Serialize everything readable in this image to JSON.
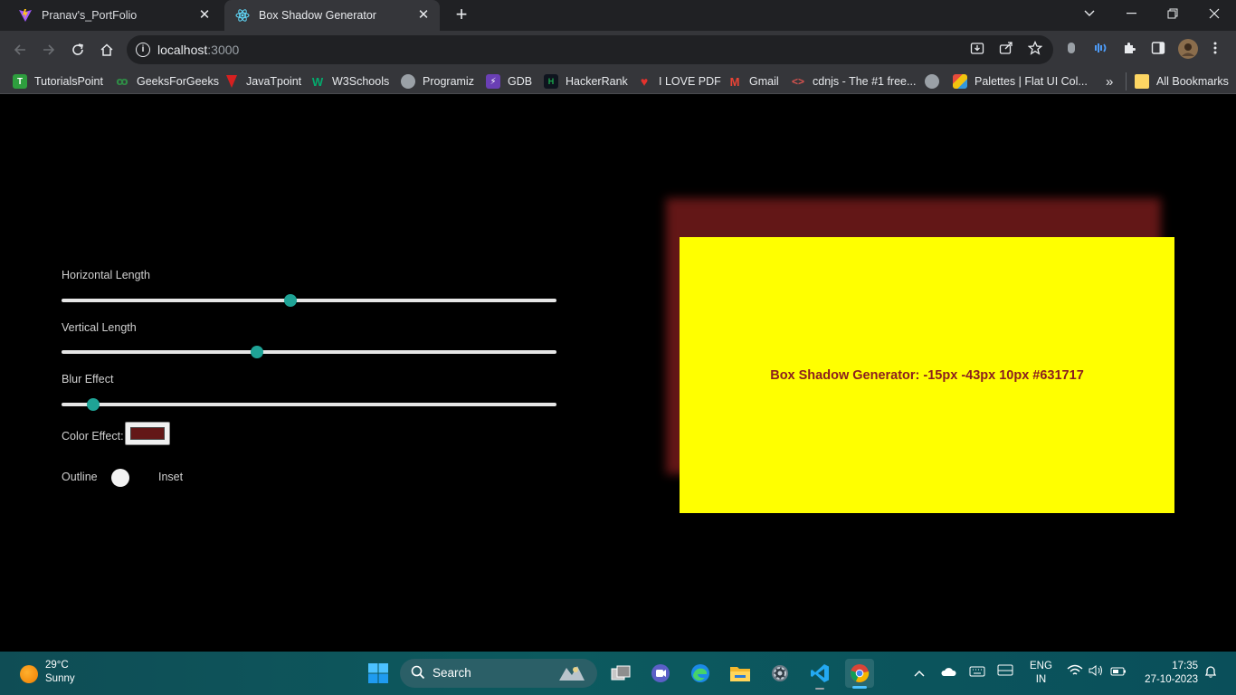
{
  "browser": {
    "tabs": [
      {
        "title": "Pranav's_PortFolio",
        "active": false,
        "icon": "vite-icon"
      },
      {
        "title": "Box Shadow Generator",
        "active": true,
        "icon": "react-icon"
      }
    ],
    "url_host": "localhost",
    "url_port": ":3000",
    "bookmarks": [
      {
        "label": "TutorialsPoint",
        "color": "#2e9e3e",
        "glyph": "T"
      },
      {
        "label": "GeeksForGeeks",
        "color": "#2f8d46",
        "glyph": "G"
      },
      {
        "label": "JavaTpoint",
        "color": "#d62020",
        "glyph": "J"
      },
      {
        "label": "W3Schools",
        "color": "#04aa6d",
        "glyph": "W"
      },
      {
        "label": "Programiz",
        "color": "#5f6368",
        "glyph": "P"
      },
      {
        "label": "GDB",
        "color": "#6a3fb5",
        "glyph": "G"
      },
      {
        "label": "HackerRank",
        "color": "#1ba94c",
        "glyph": "H"
      },
      {
        "label": "I LOVE PDF",
        "color": "#e5322d",
        "glyph": "I"
      },
      {
        "label": "Gmail",
        "color": "#ea4335",
        "glyph": "M"
      },
      {
        "label": "cdnjs - The #1 free...",
        "color": "#d9534f",
        "glyph": "<>"
      },
      {
        "label": "",
        "color": "#5f6368",
        "glyph": ""
      },
      {
        "label": "Palettes | Flat UI Col...",
        "color": "#e67e22",
        "glyph": "P"
      }
    ],
    "bookmarks_overflow": "»",
    "all_bookmarks": "All Bookmarks"
  },
  "controls": {
    "horizontal_label": "Horizontal Length",
    "horizontal_value": 0.4625,
    "vertical_label": "Vertical Length",
    "vertical_value": 0.395,
    "blur_label": "Blur Effect",
    "blur_value": 0.0635,
    "color_label": "Color Effect:",
    "color_value": "#631717",
    "toggle_left": "Outline",
    "toggle_right": "Inset"
  },
  "preview": {
    "text": "Box Shadow Generator: -15px -43px 10px #631717",
    "background": "#ffff00",
    "text_color": "#8b1f1f",
    "shadow_color": "#631717"
  },
  "taskbar": {
    "temperature": "29°C",
    "weather": "Sunny",
    "search_label": "Search",
    "lang_line1": "ENG",
    "lang_line2": "IN",
    "time": "17:35",
    "date": "27-10-2023"
  }
}
